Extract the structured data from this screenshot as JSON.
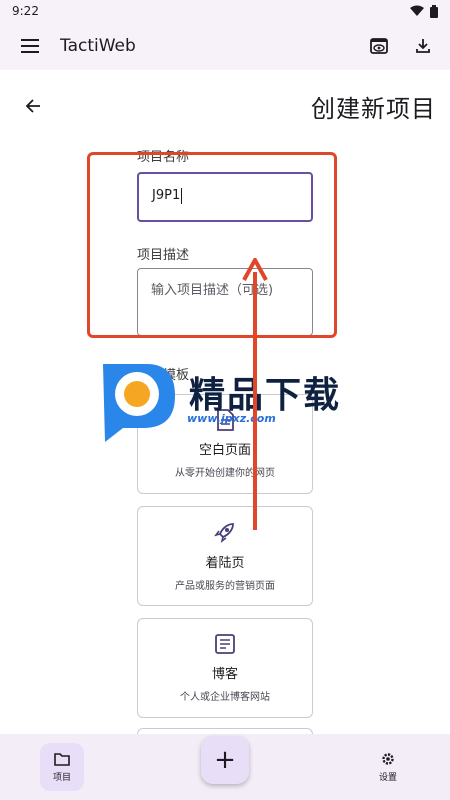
{
  "status_bar": {
    "time": "9:22"
  },
  "app_bar": {
    "title": "TactiWeb"
  },
  "page": {
    "title": "创建新项目"
  },
  "form": {
    "name_label": "项目名称",
    "name_value": "J9P1",
    "description_label": "项目描述",
    "description_placeholder": "输入项目描述（可选)",
    "template_label": "选择模板"
  },
  "templates": [
    {
      "name": "空白页面",
      "desc": "从零开始创建你的网页",
      "icon": "document-icon"
    },
    {
      "name": "着陆页",
      "desc": "产品或服务的营销页面",
      "icon": "rocket-icon"
    },
    {
      "name": "博客",
      "desc": "个人或企业博客网站",
      "icon": "article-icon"
    }
  ],
  "watermark": {
    "text": "精品下载",
    "url": "www.jpxz.com"
  },
  "bottom_nav": {
    "projects_label": "项目",
    "fab_label": "+",
    "settings_label": "设置"
  },
  "colors": {
    "accent": "#6750a4",
    "surface": "#f7f2fa",
    "highlight_red": "#e0462a",
    "nav_active": "#e8def8"
  }
}
